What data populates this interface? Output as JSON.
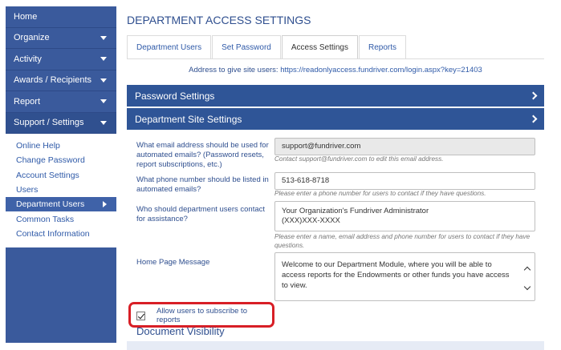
{
  "sidebar": {
    "items": [
      {
        "label": "Home",
        "has_caret": false
      },
      {
        "label": "Organize",
        "has_caret": true
      },
      {
        "label": "Activity",
        "has_caret": true
      },
      {
        "label": "Awards / Recipients",
        "has_caret": true
      },
      {
        "label": "Report",
        "has_caret": true
      },
      {
        "label": "Support / Settings",
        "has_caret": true
      }
    ],
    "sub_items": [
      {
        "label": "Online Help"
      },
      {
        "label": "Change Password"
      },
      {
        "label": "Account Settings"
      },
      {
        "label": "Users"
      },
      {
        "label": "Department Users",
        "active": true
      },
      {
        "label": "Common Tasks"
      },
      {
        "label": "Contact Information"
      }
    ]
  },
  "main": {
    "title": "DEPARTMENT ACCESS SETTINGS",
    "tabs": [
      {
        "label": "Department Users"
      },
      {
        "label": "Set Password"
      },
      {
        "label": "Access Settings",
        "active": true
      },
      {
        "label": "Reports"
      }
    ],
    "address_prefix": "Address to give site users:",
    "address_url": "https://readonlyaccess.fundriver.com/login.aspx?key=21403",
    "panels": {
      "password_settings": "Password Settings",
      "department_site_settings": "Department Site Settings"
    },
    "form": {
      "email_label": "What email address should be used for automated emails? (Password resets, report subscriptions, etc.)",
      "email_value": "support@fundriver.com",
      "email_hint": "Contact support@fundriver.com to edit this email address.",
      "phone_label": "What phone number should be listed in automated emails?",
      "phone_value": "513-618-8718",
      "phone_hint": "Please enter a phone number for users to contact if they have questions.",
      "contact_label": "Who should department users contact for assistance?",
      "contact_line1": "Your Organization's Fundriver Administrator",
      "contact_line2": "(XXX)XXX-XXXX",
      "contact_hint": "Please enter a name, email address and phone number for users to contact if they have questions.",
      "message_label": "Home Page Message",
      "message_value": "Welcome to our Department Module, where you will be able to access reports for the Endowments or other funds you have access to view.",
      "subscribe_label": "Allow users to subscribe to reports",
      "subscribe_checked": true
    },
    "document_visibility": "Document Visibility"
  },
  "colors": {
    "sidebar_bg": "#3a5a9c",
    "panel_header": "#2f5597",
    "highlight": "#d81f26",
    "link": "#2f5aa8"
  }
}
